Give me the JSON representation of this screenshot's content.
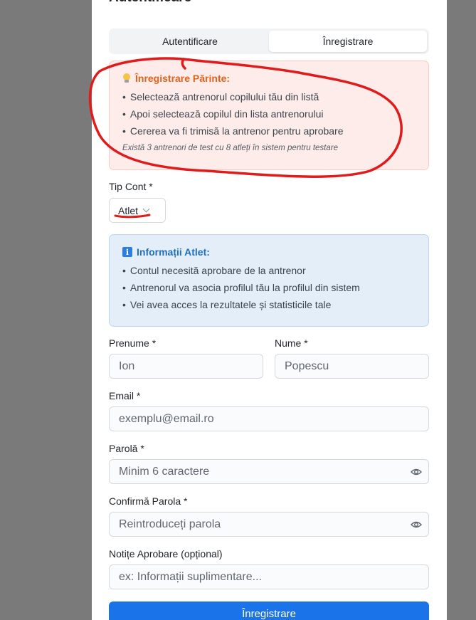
{
  "form": {
    "title": "Autentificare",
    "tabs": [
      {
        "label": "Autentificare",
        "active": false
      },
      {
        "label": "Înregistrare",
        "active": true
      }
    ]
  },
  "parent_notice": {
    "icon": "lightbulb-icon",
    "title": "Înregistrare Părinte:",
    "items": [
      "Selectează antrenorul copilului tău din listă",
      "Apoi selectează copilul din lista antrenorului",
      "Cererea va fi trimisă la antrenor pentru aprobare"
    ],
    "note": "Există 3 antrenori de test cu 8 atleți în sistem pentru testare"
  },
  "account_type": {
    "label": "Tip Cont *",
    "selected": "Atlet"
  },
  "athlete_info": {
    "icon": "info-icon",
    "title": "Informații Atlet:",
    "items": [
      "Contul necesită aprobare de la antrenor",
      "Antrenorul va asocia profilul tău la profilul din sistem",
      "Vei avea acces la rezultatele și statisticile tale"
    ]
  },
  "fields": {
    "first_name": {
      "label": "Prenume *",
      "placeholder": "Ion"
    },
    "last_name": {
      "label": "Nume *",
      "placeholder": "Popescu"
    },
    "email": {
      "label": "Email *",
      "placeholder": "exemplu@email.ro"
    },
    "password": {
      "label": "Parolă *",
      "placeholder": "Minim 6 caractere"
    },
    "confirm_password": {
      "label": "Confirmă Parola *",
      "placeholder": "Reintroduceți parola"
    },
    "notes": {
      "label": "Notițe Aprobare (opțional)",
      "placeholder": "ex: Informații suplimentare..."
    }
  },
  "submit_label": "Înregistrare",
  "colors": {
    "primary": "#1a73e8",
    "warning_title": "#e2621b",
    "info_title": "#1f6fbf",
    "annotation": "#e01b1b"
  }
}
